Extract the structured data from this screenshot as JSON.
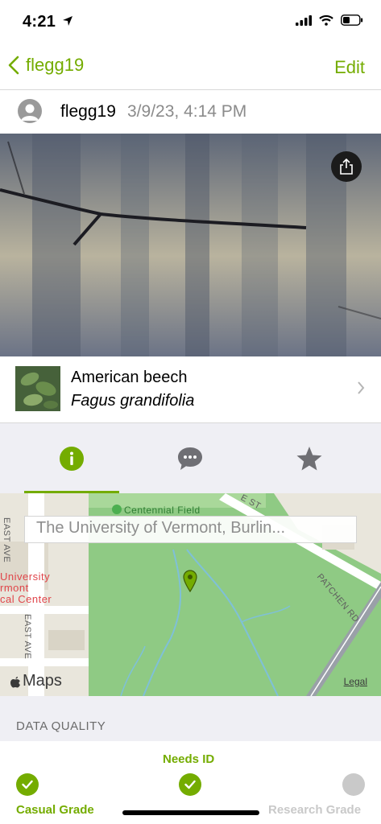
{
  "status": {
    "time": "4:21"
  },
  "nav": {
    "back_label": "flegg19",
    "edit_label": "Edit"
  },
  "observation": {
    "user": "flegg19",
    "date": "3/9/23, 4:14 PM"
  },
  "taxon": {
    "common_name": "American beech",
    "scientific_name": "Fagus grandifolia"
  },
  "tabs": [
    {
      "name": "info",
      "icon": "info-icon",
      "active": true
    },
    {
      "name": "activity",
      "icon": "speech-bubble-icon",
      "active": false
    },
    {
      "name": "favorites",
      "icon": "star-icon",
      "active": false
    }
  ],
  "map": {
    "search_text": "The University of Vermont, Burlin...",
    "labels": {
      "centennial": "Centennial Field",
      "university_1": "University",
      "university_2": "rmont",
      "university_3": "cal Center",
      "east_ave_1": "EAST AVE",
      "east_ave_2": "EAST AVE",
      "east_st": "E ST",
      "patchen": "PATCHEN RD"
    },
    "maps_label": "Maps",
    "legal_label": "Legal"
  },
  "data_quality": {
    "title": "DATA QUALITY",
    "grades": [
      {
        "label": "Casual Grade",
        "status": "complete"
      },
      {
        "label": "Needs ID",
        "status": "complete"
      },
      {
        "label": "Research Grade",
        "status": "pending"
      }
    ]
  },
  "colors": {
    "accent": "#74ac00",
    "muted": "#c9c9c9",
    "background": "#efeff4"
  }
}
